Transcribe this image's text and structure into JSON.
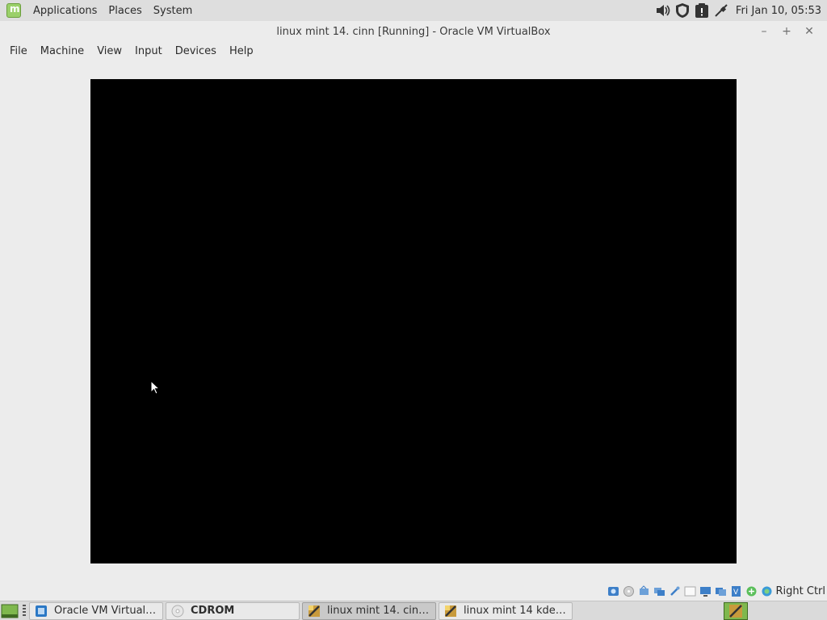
{
  "top_panel": {
    "menu": [
      "Applications",
      "Places",
      "System"
    ],
    "clock": "Fri Jan 10, 05:53"
  },
  "window": {
    "title": "linux mint 14. cinn [Running] - Oracle VM VirtualBox",
    "buttons": {
      "minimize": "–",
      "maximize": "+",
      "close": "✕"
    }
  },
  "menubar": {
    "items": [
      "File",
      "Machine",
      "View",
      "Input",
      "Devices",
      "Help"
    ]
  },
  "status_bar": {
    "host_key": "Right Ctrl"
  },
  "taskbar": {
    "tasks": [
      {
        "label": "Oracle VM VirtualB…",
        "icon": "virtualbox-icon"
      },
      {
        "label": "CDROM",
        "icon": "cdrom-icon"
      },
      {
        "label": "linux mint 14. cinn [...",
        "icon": "vm-icon"
      },
      {
        "label": "linux mint 14 kde [R...",
        "icon": "vm-icon"
      }
    ]
  },
  "colors": {
    "panel_bg": "#dedede",
    "window_bg": "#ececec",
    "vm_screen": "#000000",
    "mint_green": "#9bd06a"
  }
}
